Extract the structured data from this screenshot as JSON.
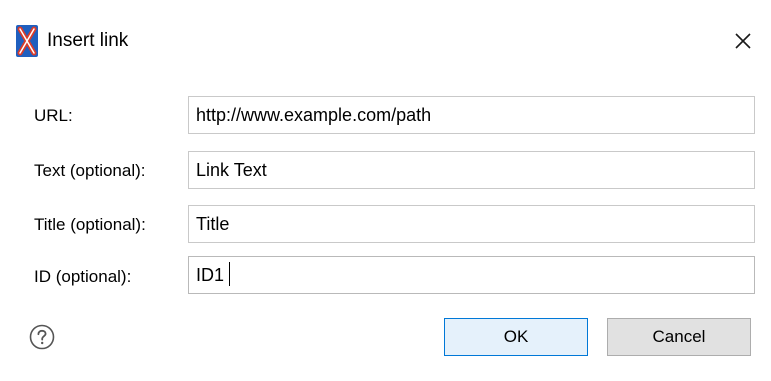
{
  "dialog": {
    "title": "Insert link",
    "app_icon": "xml-editor-app-icon",
    "close_icon": "close-icon"
  },
  "form": {
    "url_label": "URL:",
    "url_value": "http://www.example.com/path",
    "text_label": "Text (optional):",
    "text_value": "Link Text",
    "title_label": "Title (optional):",
    "title_value": "Title",
    "id_label": "ID (optional):",
    "id_value": "ID1"
  },
  "footer": {
    "help_icon": "help-icon",
    "ok_label": "OK",
    "cancel_label": "Cancel"
  },
  "colors": {
    "app_icon_blue": "#1f5fbf",
    "app_icon_red": "#d93b2b",
    "ok_border": "#0078d7",
    "ok_background": "#e5f1fb",
    "cancel_background": "#e1e1e1"
  }
}
